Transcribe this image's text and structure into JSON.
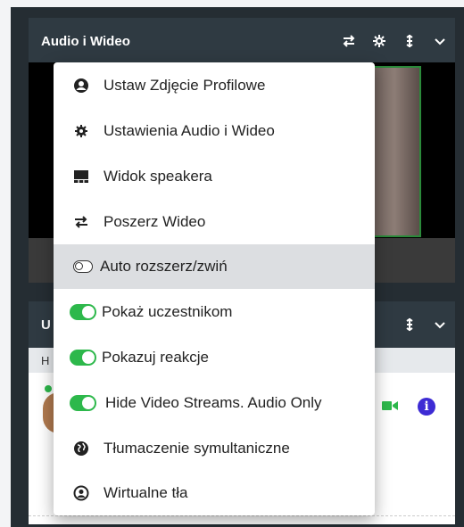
{
  "panel1": {
    "title": "Audio i Wideo"
  },
  "panel2": {
    "title_fragment": "U",
    "sub_fragment": "H"
  },
  "menu": {
    "items": [
      {
        "label": "Ustaw Zdjęcie Profilowe",
        "icon": "user-circle-icon"
      },
      {
        "label": "Ustawienia Audio i Wideo",
        "icon": "gear-icon"
      },
      {
        "label": "Widok speakera",
        "icon": "speaker-view-icon"
      },
      {
        "label": "Poszerz Wideo",
        "icon": "swap-arrows-icon"
      },
      {
        "label": "Auto rozszerz/zwiń",
        "icon": "toggle-off-icon",
        "toggle": "off",
        "highlighted": true
      },
      {
        "label": "Pokaż uczestnikom",
        "icon": "toggle-on-icon",
        "toggle": "on"
      },
      {
        "label": "Pokazuj reakcje",
        "icon": "toggle-on-icon",
        "toggle": "on"
      },
      {
        "label": "Hide Video Streams. Audio Only",
        "icon": "toggle-on-icon",
        "toggle": "on"
      },
      {
        "label": "Tłumaczenie symultaniczne",
        "icon": "globe-icon"
      },
      {
        "label": "Wirtualne tła",
        "icon": "user-circle-outline-icon"
      }
    ]
  },
  "colors": {
    "accent_green": "#2db84b",
    "info_blue": "#3d2bd4",
    "highlight": "#dcdee1"
  }
}
